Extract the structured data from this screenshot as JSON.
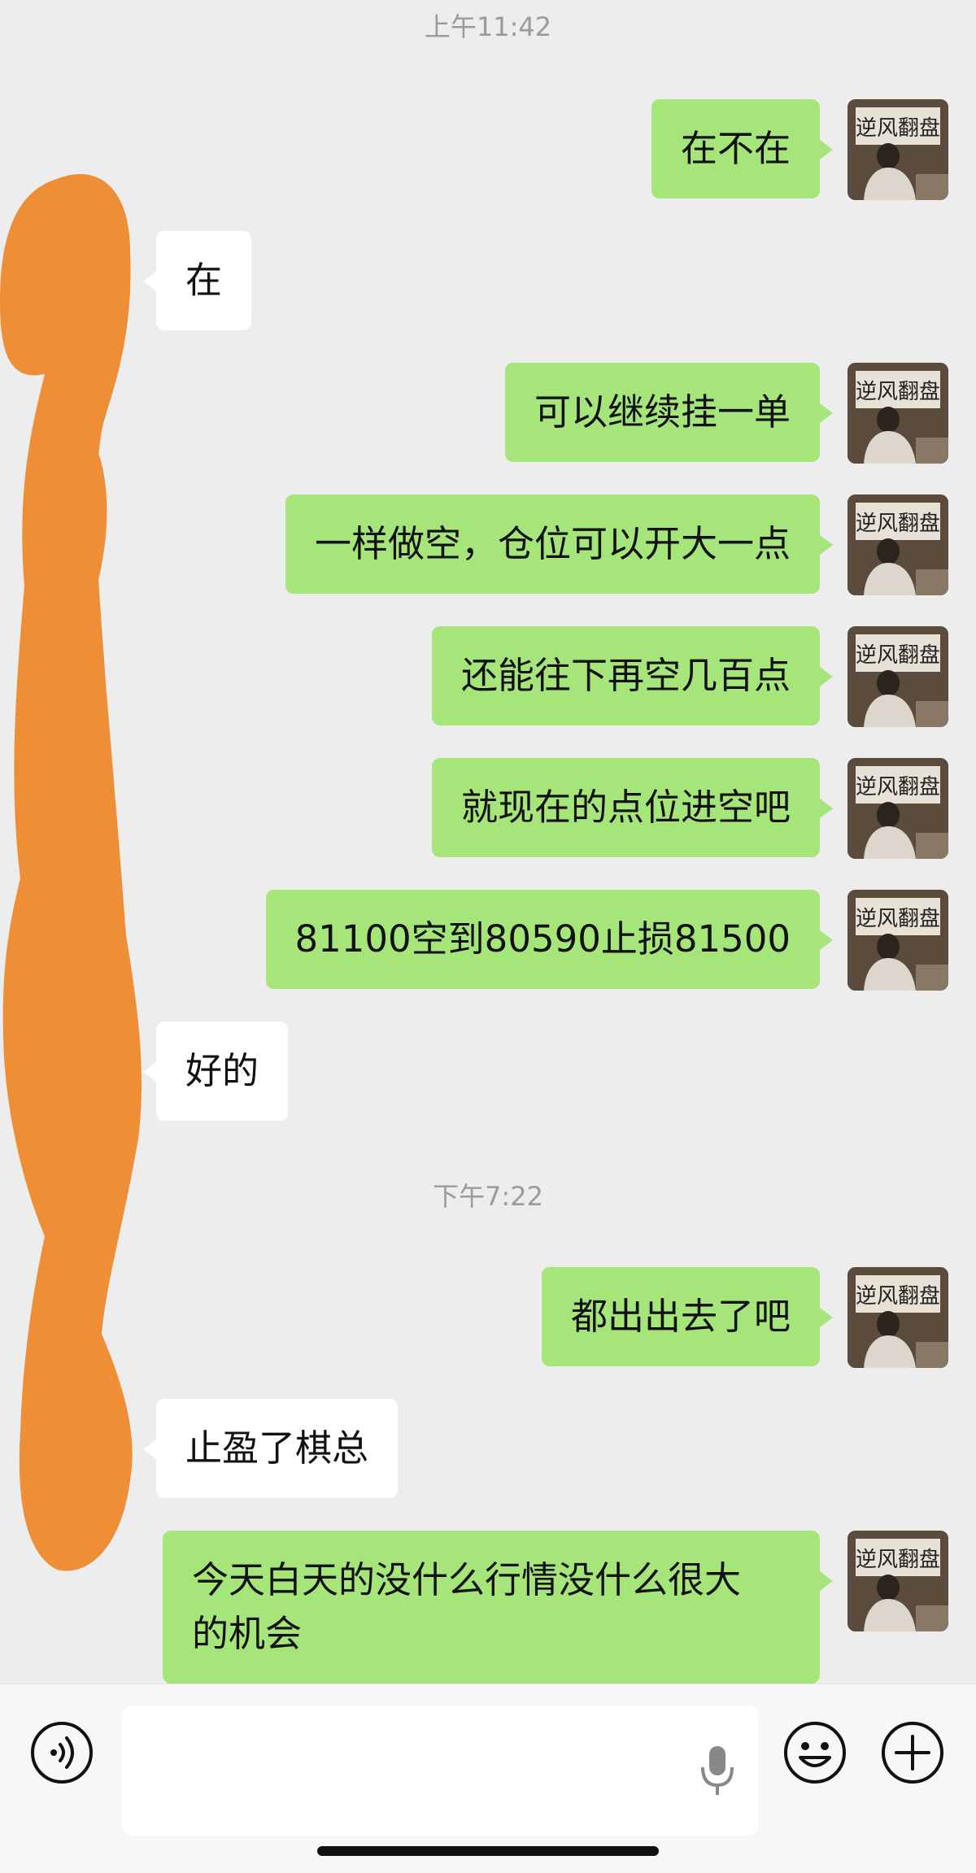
{
  "timestamps": [
    "上午11:42",
    "下午7:22"
  ],
  "messages": [
    {
      "side": "out",
      "text": "在不在"
    },
    {
      "side": "in",
      "text": "在"
    },
    {
      "side": "out",
      "text": "可以继续挂一单"
    },
    {
      "side": "out",
      "text": "一样做空，仓位可以开大一点"
    },
    {
      "side": "out",
      "text": "还能往下再空几百点"
    },
    {
      "side": "out",
      "text": "就现在的点位进空吧"
    },
    {
      "side": "out",
      "text": "81100空到80590止损81500"
    },
    {
      "side": "in",
      "text": "好的"
    },
    {
      "side": "out",
      "text": "都出出去了吧"
    },
    {
      "side": "in",
      "text": "止盈了棋总"
    },
    {
      "side": "out",
      "text": "今天白天的没什么行情没什么很大\n的机会"
    }
  ],
  "avatar": {
    "label": "逆风翻盘"
  },
  "colors": {
    "background": "#ededed",
    "outgoing_bubble": "#a5e57a",
    "incoming_bubble": "#ffffff",
    "redaction": "#ee8f37"
  },
  "input_bar": {
    "left_icon": "voice-icon",
    "mic_icon": "microphone-icon",
    "emoji_icon": "emoji-icon",
    "plus_icon": "plus-icon"
  }
}
